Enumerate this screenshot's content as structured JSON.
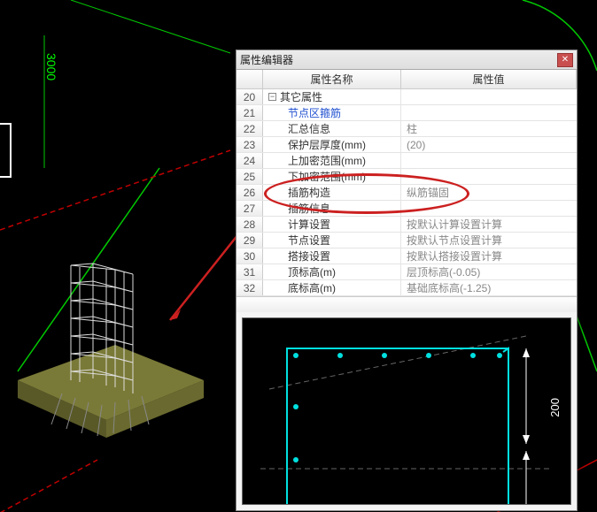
{
  "cad": {
    "dimension_text": "3000"
  },
  "dialog": {
    "title": "属性编辑器",
    "header_name": "属性名称",
    "header_value": "属性值",
    "group_label": "其它属性",
    "rows": [
      {
        "num": "20",
        "name": "其它属性",
        "val": "",
        "group": true
      },
      {
        "num": "21",
        "name": "节点区箍筋",
        "val": "",
        "blue": true
      },
      {
        "num": "22",
        "name": "汇总信息",
        "val": "柱"
      },
      {
        "num": "23",
        "name": "保护层厚度(mm)",
        "val": "(20)"
      },
      {
        "num": "24",
        "name": "上加密范围(mm)",
        "val": ""
      },
      {
        "num": "25",
        "name": "下加密范围(mm)",
        "val": ""
      },
      {
        "num": "26",
        "name": "插筋构造",
        "val": "纵筋锚固"
      },
      {
        "num": "27",
        "name": "插筋信息",
        "val": ""
      },
      {
        "num": "28",
        "name": "计算设置",
        "val": "按默认计算设置计算"
      },
      {
        "num": "29",
        "name": "节点设置",
        "val": "按默认节点设置计算"
      },
      {
        "num": "30",
        "name": "搭接设置",
        "val": "按默认搭接设置计算"
      },
      {
        "num": "31",
        "name": "顶标高(m)",
        "val": "层顶标高(-0.05)"
      },
      {
        "num": "32",
        "name": "底标高(m)",
        "val": "基础底标高(-1.25)"
      }
    ]
  },
  "preview": {
    "dimension": "200"
  }
}
